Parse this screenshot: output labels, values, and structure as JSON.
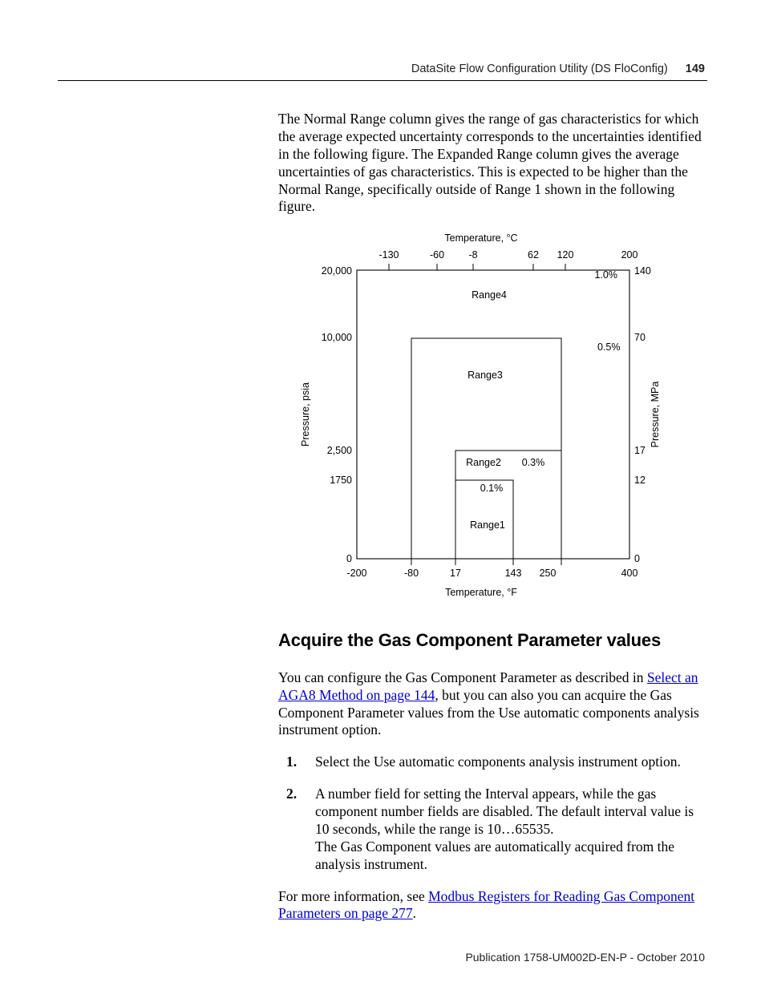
{
  "header": {
    "title": "DataSite Flow Configuration Utility (DS FloConfig)",
    "page_number": "149"
  },
  "intro_paragraph": "The Normal Range column gives the range of gas characteristics for which the average expected uncertainty corresponds to the uncertainties identified in the following figure. The Expanded Range column gives the average uncertainties of gas characteristics. This is expected to be higher than the Normal Range, specifically outside of Range 1 shown in the following figure.",
  "chart_data": {
    "type": "diagram",
    "title_top": "Temperature, °C",
    "x_label_bottom": "Temperature, °F",
    "y_left_label": "Pressure, psia",
    "y_right_label": "Pressure, MPa",
    "top_ticks_c": [
      -130,
      -60,
      -8,
      62,
      120,
      200
    ],
    "bottom_ticks_f": [
      -200,
      -80,
      17,
      143,
      250,
      400
    ],
    "left_ticks_psia": [
      "20,000",
      "10,000",
      "2,500",
      "1750",
      "0"
    ],
    "right_ticks_mpa": [
      "140",
      "70",
      "17",
      "12",
      "0"
    ],
    "regions": [
      {
        "name": "Range1",
        "uncertainty": "0.1%",
        "tempF": [
          17,
          143
        ],
        "psia": [
          0,
          1750
        ]
      },
      {
        "name": "Range2",
        "uncertainty": "0.3%",
        "tempF": [
          17,
          250
        ],
        "psia": [
          0,
          2500
        ]
      },
      {
        "name": "Range3",
        "uncertainty": "0.5%",
        "tempF": [
          -80,
          250
        ],
        "psia": [
          0,
          10000
        ]
      },
      {
        "name": "Range4",
        "uncertainty": "1.0%",
        "tempF": [
          -200,
          400
        ],
        "psia": [
          0,
          20000
        ]
      }
    ]
  },
  "section_heading": "Acquire the Gas Component Parameter values",
  "section_para_pre": "You can configure the Gas Component Parameter as described in ",
  "link1_text": "Select an AGA8 Method on page 144",
  "section_para_post": ", but you can also you can acquire the Gas Component Parameter values from the Use automatic components analysis instrument option.",
  "steps": {
    "s1": "Select the Use automatic components analysis instrument option.",
    "s2": "A number field  for setting the Interval appears, while the gas component number fields are disabled.  The default interval value is 10 seconds, while the range is 10…65535.\nThe Gas Component values are automatically acquired from the analysis instrument."
  },
  "closing_pre": "For more information, see ",
  "link2_text": "Modbus Registers for Reading Gas Component Parameters on page 277",
  "closing_post": ".",
  "footer": "Publication 1758-UM002D-EN-P - October 2010"
}
